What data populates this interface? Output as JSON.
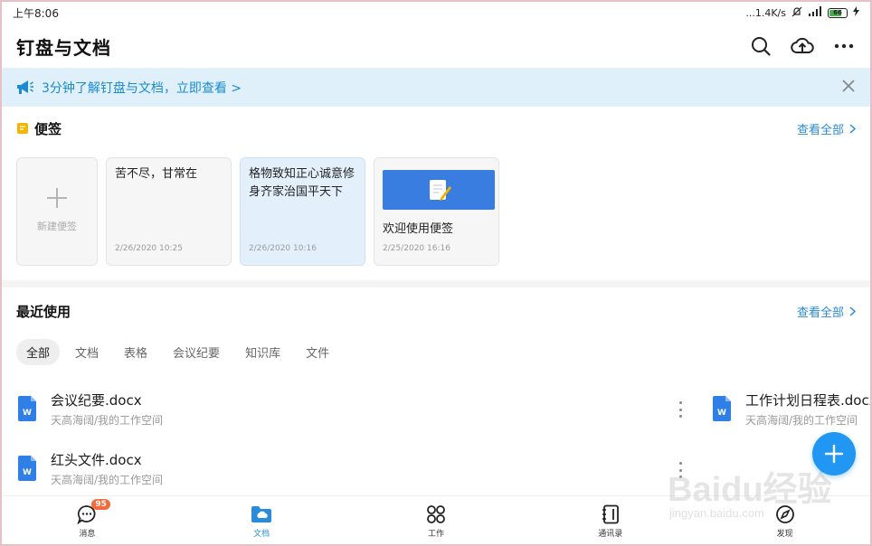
{
  "status_bar": {
    "time": "上午8:06",
    "network_speed": "...1.4K/s",
    "battery": "66"
  },
  "header": {
    "title": "钉盘与文档"
  },
  "banner": {
    "text": "3分钟了解钉盘与文档，立即查看 >"
  },
  "notes_section": {
    "title": "便签",
    "view_all": "查看全部",
    "new_label": "新建便签",
    "notes": [
      {
        "text": "苦不尽，甘常在",
        "date": "2/26/2020 10:25"
      },
      {
        "text": "格物致知正心诚意修身齐家治国平天下",
        "date": "2/26/2020 10:16"
      },
      {
        "text": "欢迎使用便签",
        "date": "2/25/2020 16:16"
      }
    ]
  },
  "recent_section": {
    "title": "最近使用",
    "view_all": "查看全部",
    "tabs": [
      "全部",
      "文档",
      "表格",
      "会议纪要",
      "知识库",
      "文件"
    ],
    "files": [
      {
        "name": "会议纪要.docx",
        "path": "天高海阔/我的工作空间"
      },
      {
        "name": "工作计划日程表.docx",
        "path": "天高海阔/我的工作空间"
      },
      {
        "name": "红头文件.docx",
        "path": "天高海阔/我的工作空间"
      }
    ]
  },
  "bottom_nav": {
    "items": [
      {
        "label": "消息",
        "badge": "95"
      },
      {
        "label": "文档"
      },
      {
        "label": "工作"
      },
      {
        "label": "通讯录"
      },
      {
        "label": "发现"
      }
    ]
  },
  "watermark": {
    "line1": "Baidu经验",
    "line2": "jingyan.baidu.com"
  },
  "colors": {
    "accent": "#2a8bd8",
    "banner_bg": "#dff0fb",
    "fab": "#2196f3",
    "badge": "#f46a3a",
    "note_icon": "#f5b400"
  }
}
